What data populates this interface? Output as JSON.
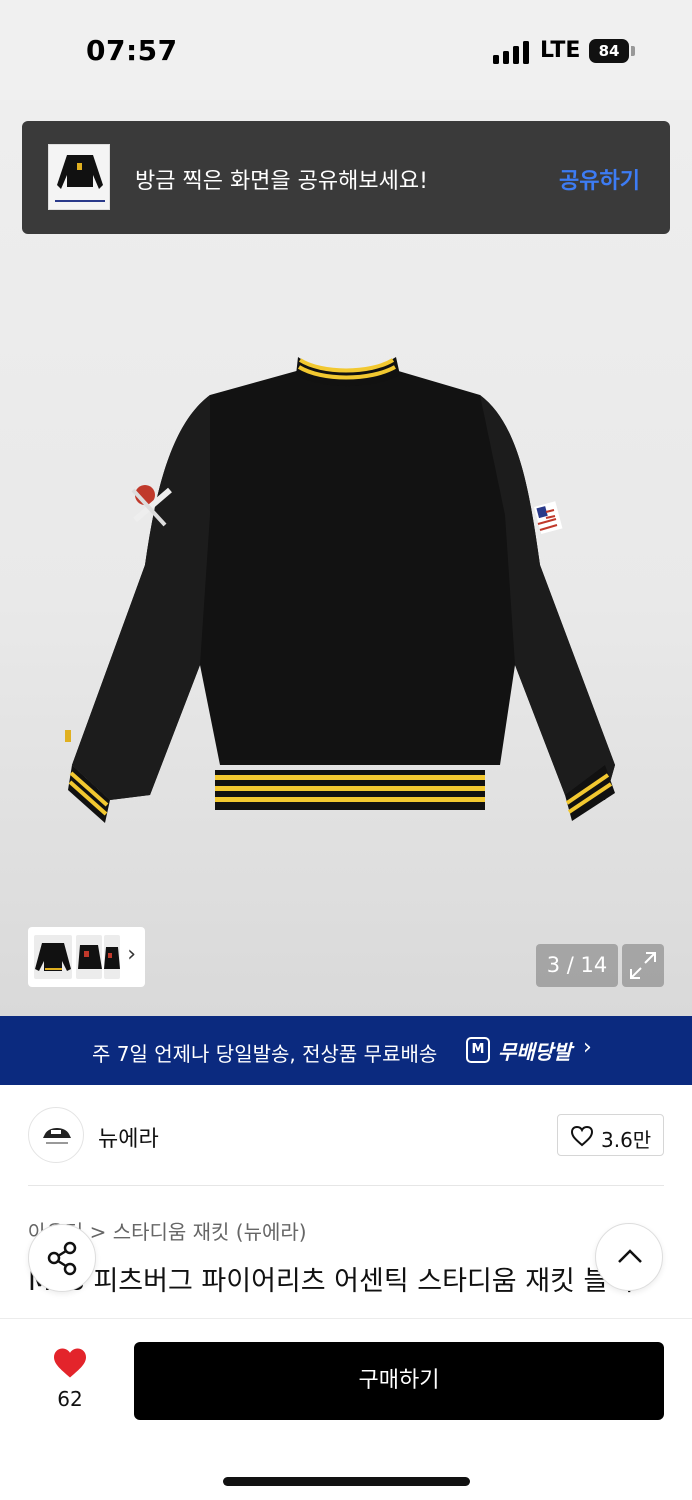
{
  "status_bar": {
    "time": "07:57",
    "network": "LTE",
    "battery": "84"
  },
  "toast": {
    "message": "방금 찍은 화면을 공유해보세요!",
    "action": "공유하기"
  },
  "gallery": {
    "counter": "3 / 14"
  },
  "shipping": {
    "text": "주 7일 언제나 당일발송, 전상품 무료배송",
    "badge": "M",
    "brand": "무배당발"
  },
  "brand": {
    "name": "뉴에라",
    "likes": "3.6만"
  },
  "breadcrumb": {
    "category": "아우터",
    "separator": ">",
    "subcategory": "스타디움 재킷 (뉴에라)"
  },
  "product": {
    "title": "MLB 피츠버그 파이어리츠 어센틱 스타디움 재킷 블랙"
  },
  "bottom_bar": {
    "wish_count": "62",
    "buy_label": "구매하기"
  },
  "colors": {
    "accent": "#3d7cf4",
    "banner": "#0b2a7f",
    "heart": "#e3242b"
  }
}
